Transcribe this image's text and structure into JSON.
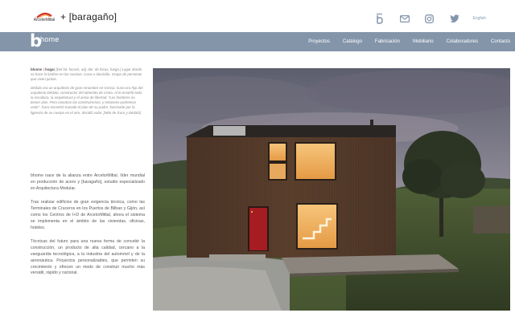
{
  "brand": {
    "arcelor_text": "ArcelorMittal",
    "plus_text": "+ [baragaño]"
  },
  "top_icons": [
    "bhome-b-icon",
    "mail-icon",
    "instagram-icon",
    "twitter-icon"
  ],
  "lang": "English",
  "nav": {
    "logo_b": "b",
    "logo_home": "home",
    "items": [
      "Proyectos",
      "Catálogo",
      "Fabricación",
      "Mobiliario",
      "Colaboradores",
      "Contacto"
    ]
  },
  "intro": {
    "term": "bhome",
    "sep": "|",
    "word": "hogar",
    "definition": "[Del lat. focaris, adj. der. de focus, fuego.] Lugar donde se hace la lumbre en las cocinas. Casa o domicilio. Grupo de personas que viven juntas.",
    "myth": "Dédalo era un arquitecto de gran renombre en Grecia. Ícaro era hijo del arquitecto Dédalo, constructor del laberinto de Creta. Al le enseñó todo: la escultura, la arquitectura y el ansia de libertad. \"Los hombres no tienen alas. Pero nosotros las construiremos, y entonces podremos volar\". Ícaro encontró trazado el plan de su padre, fascinado por la ligereza de su cuerpo en el aire, decidió volar. [Mito de Ícaro y Dédalo]"
  },
  "body": [
    "bhome nace de la alianza entre ArcelorMittal, líder mundial en producción de acero y [baragaño], estudio especializado en Arquitectura Modular.",
    "Tras realizar edificios de gran exigencia técnica, como las Terminales de Cruceros en los Puertos de Bilbao y Gijón, así como los Centros de I+D de ArcelorMittal, ahora el sistema se implementa en el ámbito de las viviendas, oficinas, hoteles.",
    "Técnicas del futuro para una nueva forma de concebir la construcción, un producto de alta calidad, cercano a la vanguardia tecnológica, a la industria del automóvil y de la aeronáutica. Proyectos personalizables, que permiten su crecimiento y ofrecen un modo de construir mucho más versátil, rápido y racional."
  ],
  "colors": {
    "nav_bg": "#8495aa",
    "accent": "#6b7f9a",
    "text": "#5a5a5a"
  }
}
